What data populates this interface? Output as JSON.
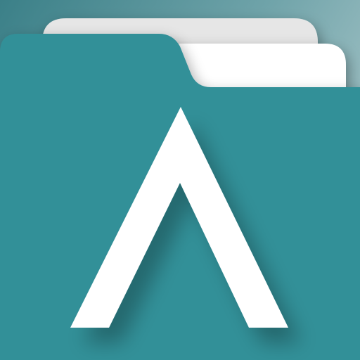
{
  "app_icon": {
    "icon_name": "folder-with-caret-logo-icon",
    "colors": {
      "background_light": "#a9c6c9",
      "background_dark": "#3e848b",
      "folder_teal": "#339098",
      "folder_teal_shadow": "#2a7b82",
      "paper_back": "#e6e6e6",
      "paper_front": "#ffffff",
      "logo_mark": "#ffffff"
    }
  }
}
